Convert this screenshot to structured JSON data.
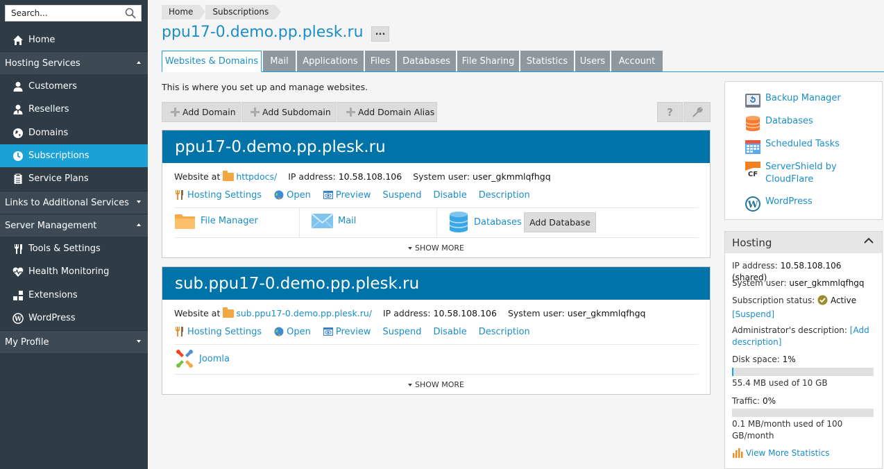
{
  "sidebar": {
    "search_placeholder": "Search...",
    "home": "Home",
    "hosting_services": "Hosting Services",
    "customers": "Customers",
    "resellers": "Resellers",
    "domains": "Domains",
    "subscriptions": "Subscriptions",
    "service_plans": "Service Plans",
    "links_additional": "Links to Additional Services",
    "server_management": "Server Management",
    "tools_settings": "Tools & Settings",
    "health_monitoring": "Health Monitoring",
    "extensions": "Extensions",
    "wordpress": "WordPress",
    "my_profile": "My Profile"
  },
  "breadcrumb": {
    "home": "Home",
    "subscriptions": "Subscriptions"
  },
  "page_title": "ppu17-0.demo.pp.plesk.ru",
  "more_label": "...",
  "tabs": [
    "Websites & Domains",
    "Mail",
    "Applications",
    "Files",
    "Databases",
    "File Sharing",
    "Statistics",
    "Users",
    "Account"
  ],
  "intro": "This is where you set up and manage websites.",
  "toolbar": {
    "add_domain": "Add Domain",
    "add_subdomain": "Add Subdomain",
    "add_alias": "Add Domain Alias",
    "help": "?"
  },
  "domains": [
    {
      "name": "ppu17-0.demo.pp.plesk.ru",
      "website_at": "Website at",
      "docroot": "httpdocs/",
      "ip_label": "IP address:",
      "ip": "10.58.108.106",
      "user_label": "System user:",
      "user": "user_gkmmlqfhgq",
      "actions": {
        "hosting": "Hosting Settings",
        "open": "Open",
        "preview": "Preview",
        "suspend": "Suspend",
        "disable": "Disable",
        "description": "Description"
      },
      "tools": {
        "file_manager": "File Manager",
        "mail": "Mail",
        "databases": "Databases",
        "add_database": "Add Database"
      },
      "show_more": "SHOW MORE"
    },
    {
      "name": "sub.ppu17-0.demo.pp.plesk.ru",
      "website_at": "Website at",
      "docroot": "sub.ppu17-0.demo.pp.plesk.ru/",
      "ip_label": "IP address:",
      "ip": "10.58.108.106",
      "user_label": "System user:",
      "user": "user_gkmmlqfhgq",
      "actions": {
        "hosting": "Hosting Settings",
        "open": "Open",
        "preview": "Preview",
        "suspend": "Suspend",
        "disable": "Disable",
        "description": "Description"
      },
      "tools": {
        "joomla": "Joomla"
      },
      "show_more": "SHOW MORE"
    }
  ],
  "tools_panel": {
    "backup": "Backup Manager",
    "databases": "Databases",
    "scheduled": "Scheduled Tasks",
    "servershield_1": "ServerShield by",
    "servershield_2": "CloudFlare",
    "wordpress": "WordPress"
  },
  "hosting": {
    "title": "Hosting",
    "ip_label": "IP address:",
    "ip": "10.58.108.106 (shared)",
    "user_label": "System user:",
    "user": "user_gkmmlqfhgq",
    "status_label": "Subscription status:",
    "status": "Active",
    "suspend": "[Suspend]",
    "admin_desc_label": "Administrator's description:",
    "admin_desc_link_1": "[Add",
    "admin_desc_link_2": "description]",
    "disk_label": "Disk space:",
    "disk": "1%",
    "disk_percent": 1,
    "disk_used": "55.4 MB used of 10 GB",
    "traffic_label": "Traffic:",
    "traffic": "0%",
    "traffic_percent": 0,
    "traffic_used_1": "0.1 MB/month used of 100",
    "traffic_used_2": "GB/month",
    "view_stats": "View More Statistics"
  },
  "colors": {
    "accent": "#1ba1d6",
    "sidebar": "#2f3b45",
    "domain_header": "#0074a8",
    "link": "#1a8ec8"
  }
}
